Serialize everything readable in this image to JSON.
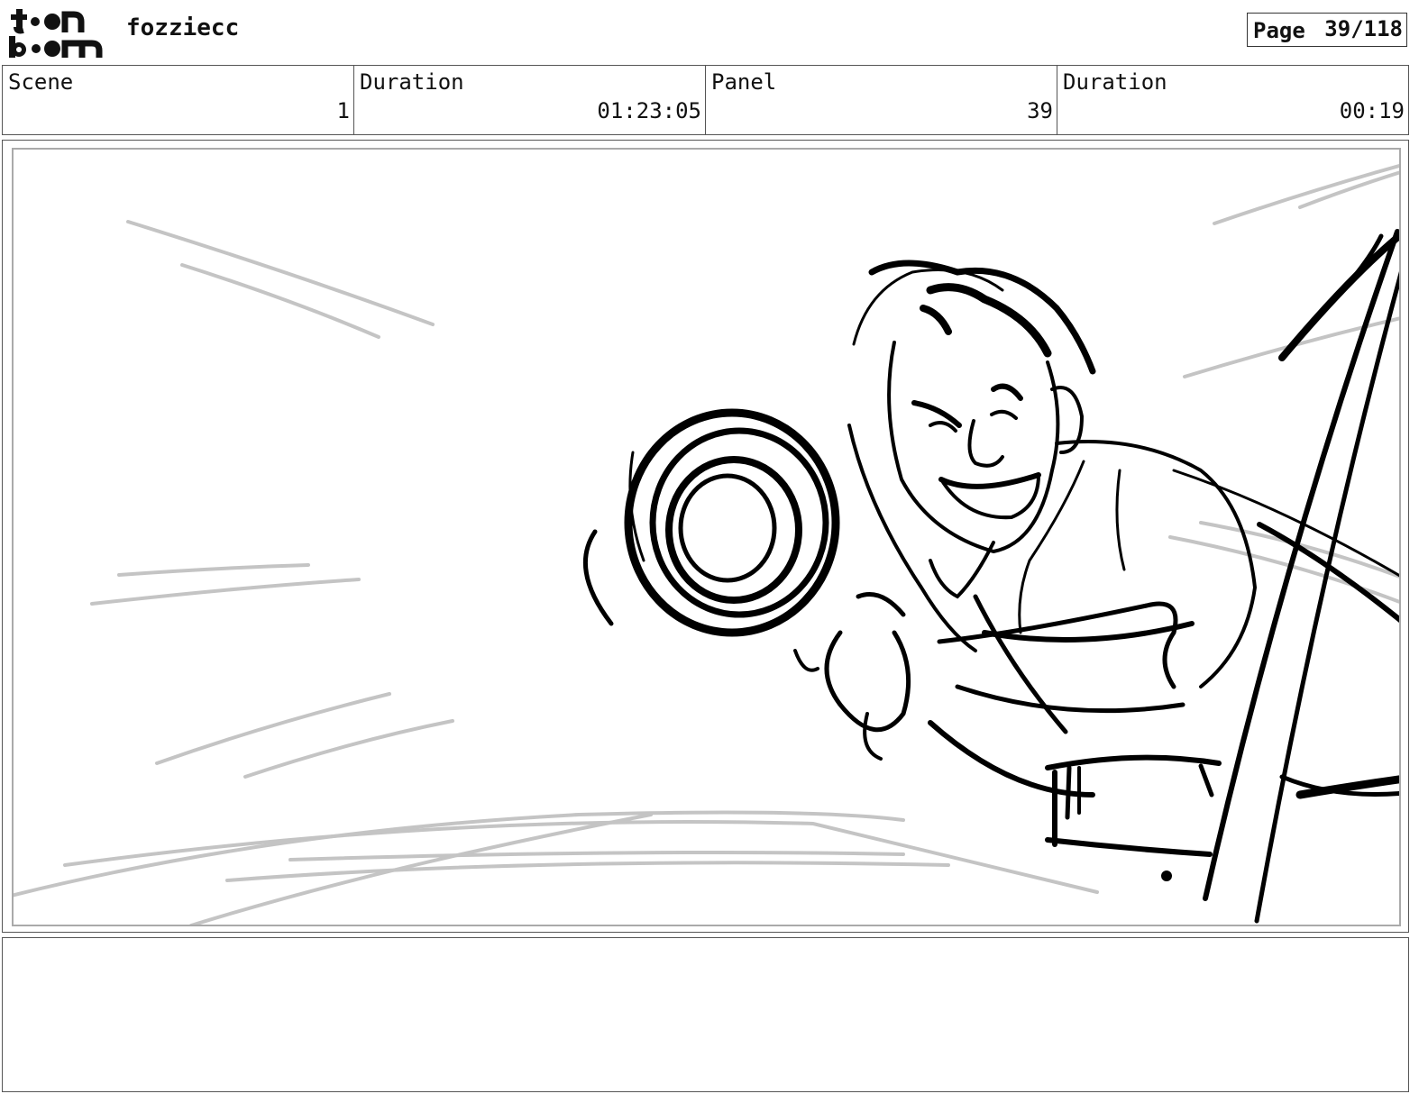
{
  "header": {
    "logo_text": "toon boom",
    "project_name": "fozziecc",
    "page_label": "Page",
    "page_value": "39/118"
  },
  "info": {
    "scene_label": "Scene",
    "scene_value": "1",
    "scene_duration_label": "Duration",
    "scene_duration_value": "01:23:05",
    "panel_label": "Panel",
    "panel_value": "39",
    "panel_duration_label": "Duration",
    "panel_duration_value": "00:19"
  },
  "panel_image": {
    "icon": "storyboard-sketch-man-throwing-rope",
    "stroke_color": "#000000",
    "speedline_color": "#c4c4c4"
  },
  "notes": {
    "text": ""
  }
}
